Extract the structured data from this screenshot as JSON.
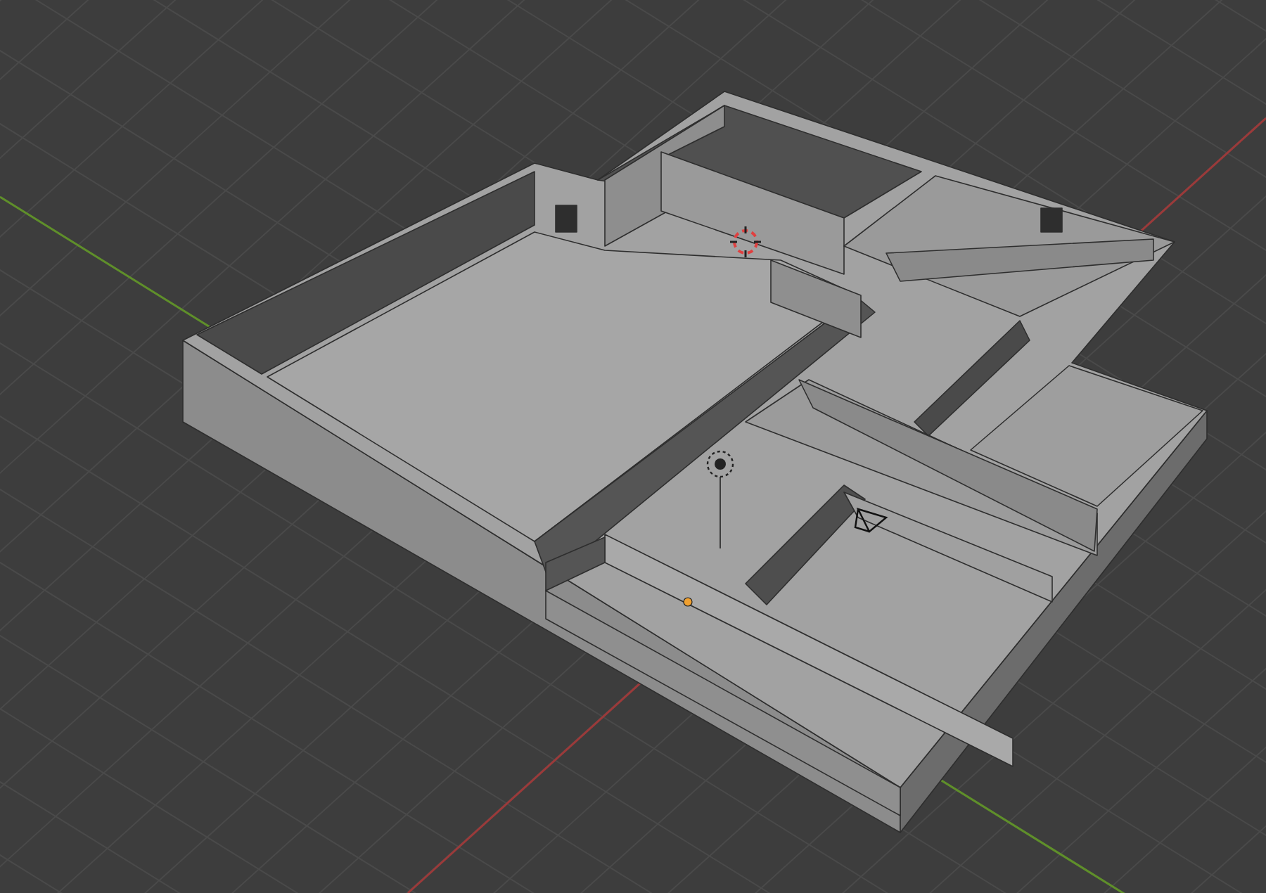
{
  "viewport": {
    "axes": [
      {
        "kind": "x",
        "color": "#9b3a3a"
      },
      {
        "kind": "y",
        "color": "#5f8f2a"
      }
    ],
    "overlays": [
      {
        "kind": "cursor"
      },
      {
        "kind": "light"
      },
      {
        "kind": "camera"
      },
      {
        "kind": "origin"
      }
    ]
  }
}
